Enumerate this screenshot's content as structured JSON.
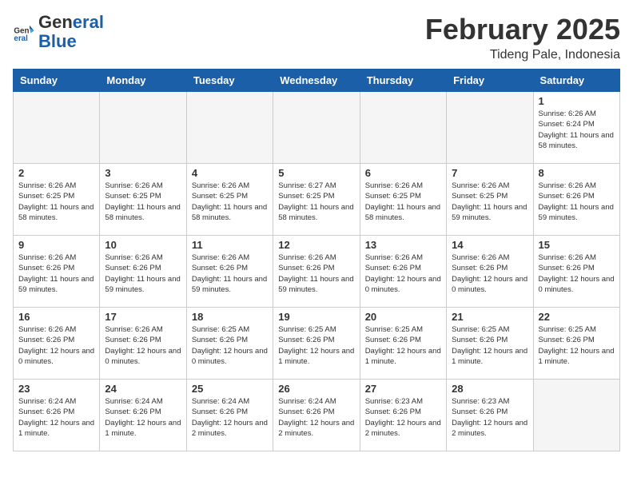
{
  "header": {
    "logo_general": "General",
    "logo_blue": "Blue",
    "month": "February 2025",
    "location": "Tideng Pale, Indonesia"
  },
  "weekdays": [
    "Sunday",
    "Monday",
    "Tuesday",
    "Wednesday",
    "Thursday",
    "Friday",
    "Saturday"
  ],
  "weeks": [
    [
      {
        "day": "",
        "info": "",
        "empty": true
      },
      {
        "day": "",
        "info": "",
        "empty": true
      },
      {
        "day": "",
        "info": "",
        "empty": true
      },
      {
        "day": "",
        "info": "",
        "empty": true
      },
      {
        "day": "",
        "info": "",
        "empty": true
      },
      {
        "day": "",
        "info": "",
        "empty": true
      },
      {
        "day": "1",
        "info": "Sunrise: 6:26 AM\nSunset: 6:24 PM\nDaylight: 11 hours\nand 58 minutes."
      }
    ],
    [
      {
        "day": "2",
        "info": "Sunrise: 6:26 AM\nSunset: 6:25 PM\nDaylight: 11 hours\nand 58 minutes."
      },
      {
        "day": "3",
        "info": "Sunrise: 6:26 AM\nSunset: 6:25 PM\nDaylight: 11 hours\nand 58 minutes."
      },
      {
        "day": "4",
        "info": "Sunrise: 6:26 AM\nSunset: 6:25 PM\nDaylight: 11 hours\nand 58 minutes."
      },
      {
        "day": "5",
        "info": "Sunrise: 6:27 AM\nSunset: 6:25 PM\nDaylight: 11 hours\nand 58 minutes."
      },
      {
        "day": "6",
        "info": "Sunrise: 6:26 AM\nSunset: 6:25 PM\nDaylight: 11 hours\nand 58 minutes."
      },
      {
        "day": "7",
        "info": "Sunrise: 6:26 AM\nSunset: 6:25 PM\nDaylight: 11 hours\nand 59 minutes."
      },
      {
        "day": "8",
        "info": "Sunrise: 6:26 AM\nSunset: 6:26 PM\nDaylight: 11 hours\nand 59 minutes."
      }
    ],
    [
      {
        "day": "9",
        "info": "Sunrise: 6:26 AM\nSunset: 6:26 PM\nDaylight: 11 hours\nand 59 minutes."
      },
      {
        "day": "10",
        "info": "Sunrise: 6:26 AM\nSunset: 6:26 PM\nDaylight: 11 hours\nand 59 minutes."
      },
      {
        "day": "11",
        "info": "Sunrise: 6:26 AM\nSunset: 6:26 PM\nDaylight: 11 hours\nand 59 minutes."
      },
      {
        "day": "12",
        "info": "Sunrise: 6:26 AM\nSunset: 6:26 PM\nDaylight: 11 hours\nand 59 minutes."
      },
      {
        "day": "13",
        "info": "Sunrise: 6:26 AM\nSunset: 6:26 PM\nDaylight: 12 hours\nand 0 minutes."
      },
      {
        "day": "14",
        "info": "Sunrise: 6:26 AM\nSunset: 6:26 PM\nDaylight: 12 hours\nand 0 minutes."
      },
      {
        "day": "15",
        "info": "Sunrise: 6:26 AM\nSunset: 6:26 PM\nDaylight: 12 hours\nand 0 minutes."
      }
    ],
    [
      {
        "day": "16",
        "info": "Sunrise: 6:26 AM\nSunset: 6:26 PM\nDaylight: 12 hours\nand 0 minutes."
      },
      {
        "day": "17",
        "info": "Sunrise: 6:26 AM\nSunset: 6:26 PM\nDaylight: 12 hours\nand 0 minutes."
      },
      {
        "day": "18",
        "info": "Sunrise: 6:25 AM\nSunset: 6:26 PM\nDaylight: 12 hours\nand 0 minutes."
      },
      {
        "day": "19",
        "info": "Sunrise: 6:25 AM\nSunset: 6:26 PM\nDaylight: 12 hours\nand 1 minute."
      },
      {
        "day": "20",
        "info": "Sunrise: 6:25 AM\nSunset: 6:26 PM\nDaylight: 12 hours\nand 1 minute."
      },
      {
        "day": "21",
        "info": "Sunrise: 6:25 AM\nSunset: 6:26 PM\nDaylight: 12 hours\nand 1 minute."
      },
      {
        "day": "22",
        "info": "Sunrise: 6:25 AM\nSunset: 6:26 PM\nDaylight: 12 hours\nand 1 minute."
      }
    ],
    [
      {
        "day": "23",
        "info": "Sunrise: 6:24 AM\nSunset: 6:26 PM\nDaylight: 12 hours\nand 1 minute."
      },
      {
        "day": "24",
        "info": "Sunrise: 6:24 AM\nSunset: 6:26 PM\nDaylight: 12 hours\nand 1 minute."
      },
      {
        "day": "25",
        "info": "Sunrise: 6:24 AM\nSunset: 6:26 PM\nDaylight: 12 hours\nand 2 minutes."
      },
      {
        "day": "26",
        "info": "Sunrise: 6:24 AM\nSunset: 6:26 PM\nDaylight: 12 hours\nand 2 minutes."
      },
      {
        "day": "27",
        "info": "Sunrise: 6:23 AM\nSunset: 6:26 PM\nDaylight: 12 hours\nand 2 minutes."
      },
      {
        "day": "28",
        "info": "Sunrise: 6:23 AM\nSunset: 6:26 PM\nDaylight: 12 hours\nand 2 minutes."
      },
      {
        "day": "",
        "info": "",
        "empty": true
      }
    ]
  ]
}
